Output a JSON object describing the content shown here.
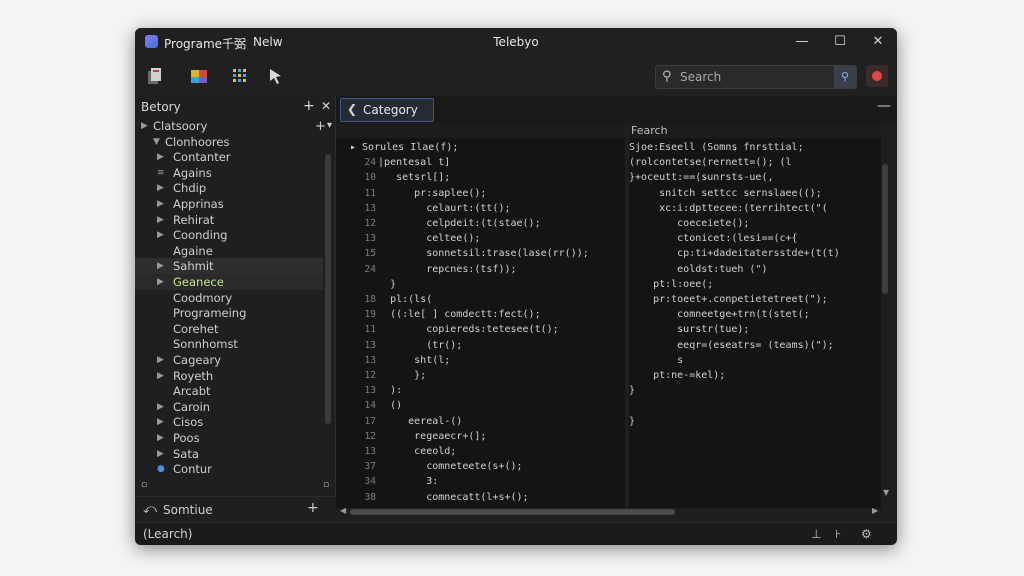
{
  "titlebar": {
    "app_name": "Programe千弼",
    "menu_new": "Nelw",
    "window_title": "Telebyo",
    "minimize": "—",
    "maximize": "☐",
    "close": "✕"
  },
  "search": {
    "placeholder": "Search"
  },
  "sidebar": {
    "header": "Betory",
    "items": [
      {
        "label": "Clatsoory",
        "arrow": "▶",
        "indent": 0
      },
      {
        "label": "Clonhoores",
        "arrow": "▼",
        "indent": 1
      },
      {
        "label": "Contanter",
        "arrow": "▶",
        "indent": 2
      },
      {
        "label": "Agains",
        "arrow": "≡",
        "indent": 2
      },
      {
        "label": "Chdip",
        "arrow": "▶",
        "indent": 2
      },
      {
        "label": "Apprinas",
        "arrow": "▶",
        "indent": 2
      },
      {
        "label": "Rehirat",
        "arrow": "▶",
        "indent": 2
      },
      {
        "label": "Coonding",
        "arrow": "▶",
        "indent": 2
      },
      {
        "label": "Againe",
        "arrow": "",
        "indent": 2
      },
      {
        "label": "Sahmit",
        "arrow": "▶",
        "indent": 2
      },
      {
        "label": "Geanece",
        "arrow": "▶",
        "indent": 2
      },
      {
        "label": "Coodmory",
        "arrow": "",
        "indent": 2
      },
      {
        "label": "Programeing",
        "arrow": "",
        "indent": 2
      },
      {
        "label": "Corehet",
        "arrow": "",
        "indent": 2
      },
      {
        "label": "Sonnhomst",
        "arrow": "",
        "indent": 2
      },
      {
        "label": "Cageary",
        "arrow": "▶",
        "indent": 2
      },
      {
        "label": "Royeth",
        "arrow": "▶",
        "indent": 2
      },
      {
        "label": "Arcabt",
        "arrow": "",
        "indent": 2
      },
      {
        "label": "Caroin",
        "arrow": "▶",
        "indent": 2
      },
      {
        "label": "Cisos",
        "arrow": "▶",
        "indent": 2
      },
      {
        "label": "Poos",
        "arrow": "▶",
        "indent": 2
      },
      {
        "label": "Sata",
        "arrow": "▶",
        "indent": 2
      },
      {
        "label": "Contur",
        "arrow": "●",
        "indent": 2
      }
    ],
    "footer_label": "Somtiue"
  },
  "status": {
    "text": "(Learch)"
  },
  "editor": {
    "tab_label": "Category",
    "right_header": "Fearch",
    "left_lines": [
      {
        "n": "",
        "t": "▸ Sorules Ilae(f);"
      },
      {
        "n": "24",
        "t": "  |pentesal t]"
      },
      {
        "n": "10",
        "t": "     setsrl[];"
      },
      {
        "n": "11",
        "t": "        pr:saplee();"
      },
      {
        "n": "13",
        "t": "          celaurt:(tt();"
      },
      {
        "n": "12",
        "t": "          celpdeit:(t(stae();"
      },
      {
        "n": "13",
        "t": "          celtee();"
      },
      {
        "n": "15",
        "t": "          sonnetsil:trase(lase(rr());"
      },
      {
        "n": "24",
        "t": "          repcnes:(tsf));"
      },
      {
        "n": "",
        "t": "    }"
      },
      {
        "n": "18",
        "t": "    pl:(ls("
      },
      {
        "n": "19",
        "t": "    ((:le[ ] comdectt:fect();"
      },
      {
        "n": "11",
        "t": "          copiereds:tetesee(t();"
      },
      {
        "n": "13",
        "t": "          (tr();"
      },
      {
        "n": "13",
        "t": "        sht(l;"
      },
      {
        "n": "12",
        "t": "        };"
      },
      {
        "n": "13",
        "t": "    ):"
      },
      {
        "n": "14",
        "t": "    ()"
      },
      {
        "n": "17",
        "t": "       eereal-()"
      },
      {
        "n": "12",
        "t": "        regeaecr+(];"
      },
      {
        "n": "13",
        "t": "        ceeold;"
      },
      {
        "n": "37",
        "t": "          comneteete(s+();"
      },
      {
        "n": "34",
        "t": "          3:"
      },
      {
        "n": "38",
        "t": "          comnecatt(l+s+();"
      }
    ],
    "right_lines": [
      {
        "t": "Sjoe:Eseell (Somns fnrsttial;"
      },
      {
        "t": "(rolcontetse(rernett=(); (l"
      },
      {
        "t": "}+oceutt:==(sunrsts-ue(,"
      },
      {
        "t": "     snitch settcc sernslaee(();"
      },
      {
        "t": "     xc:i:dpttecee:(terrihtect(\"("
      },
      {
        "t": "        coeceiete();"
      },
      {
        "t": "        ctonicet:(lesi==(c+{"
      },
      {
        "t": "        cp:ti+dadeitatersstde+(t(t)"
      },
      {
        "t": "        eoldst:tueh (\")"
      },
      {
        "t": "    pt:l:oee(;"
      },
      {
        "t": "    pr:toeet+.conpetietetreet(\");"
      },
      {
        "t": "        comneetge+trn(t(stet(;"
      },
      {
        "t": "        surstr(tue);"
      },
      {
        "t": "        eeqr=(eseatrs= (teams)(\");"
      },
      {
        "t": "        s"
      },
      {
        "t": "    pt:ne-=kel);"
      },
      {
        "t": "}"
      },
      {
        "t": ""
      },
      {
        "t": "}"
      }
    ]
  },
  "icons": {
    "toolbar": [
      "pages-icon",
      "palette-icon",
      "grid-icon",
      "cursor-icon"
    ]
  }
}
